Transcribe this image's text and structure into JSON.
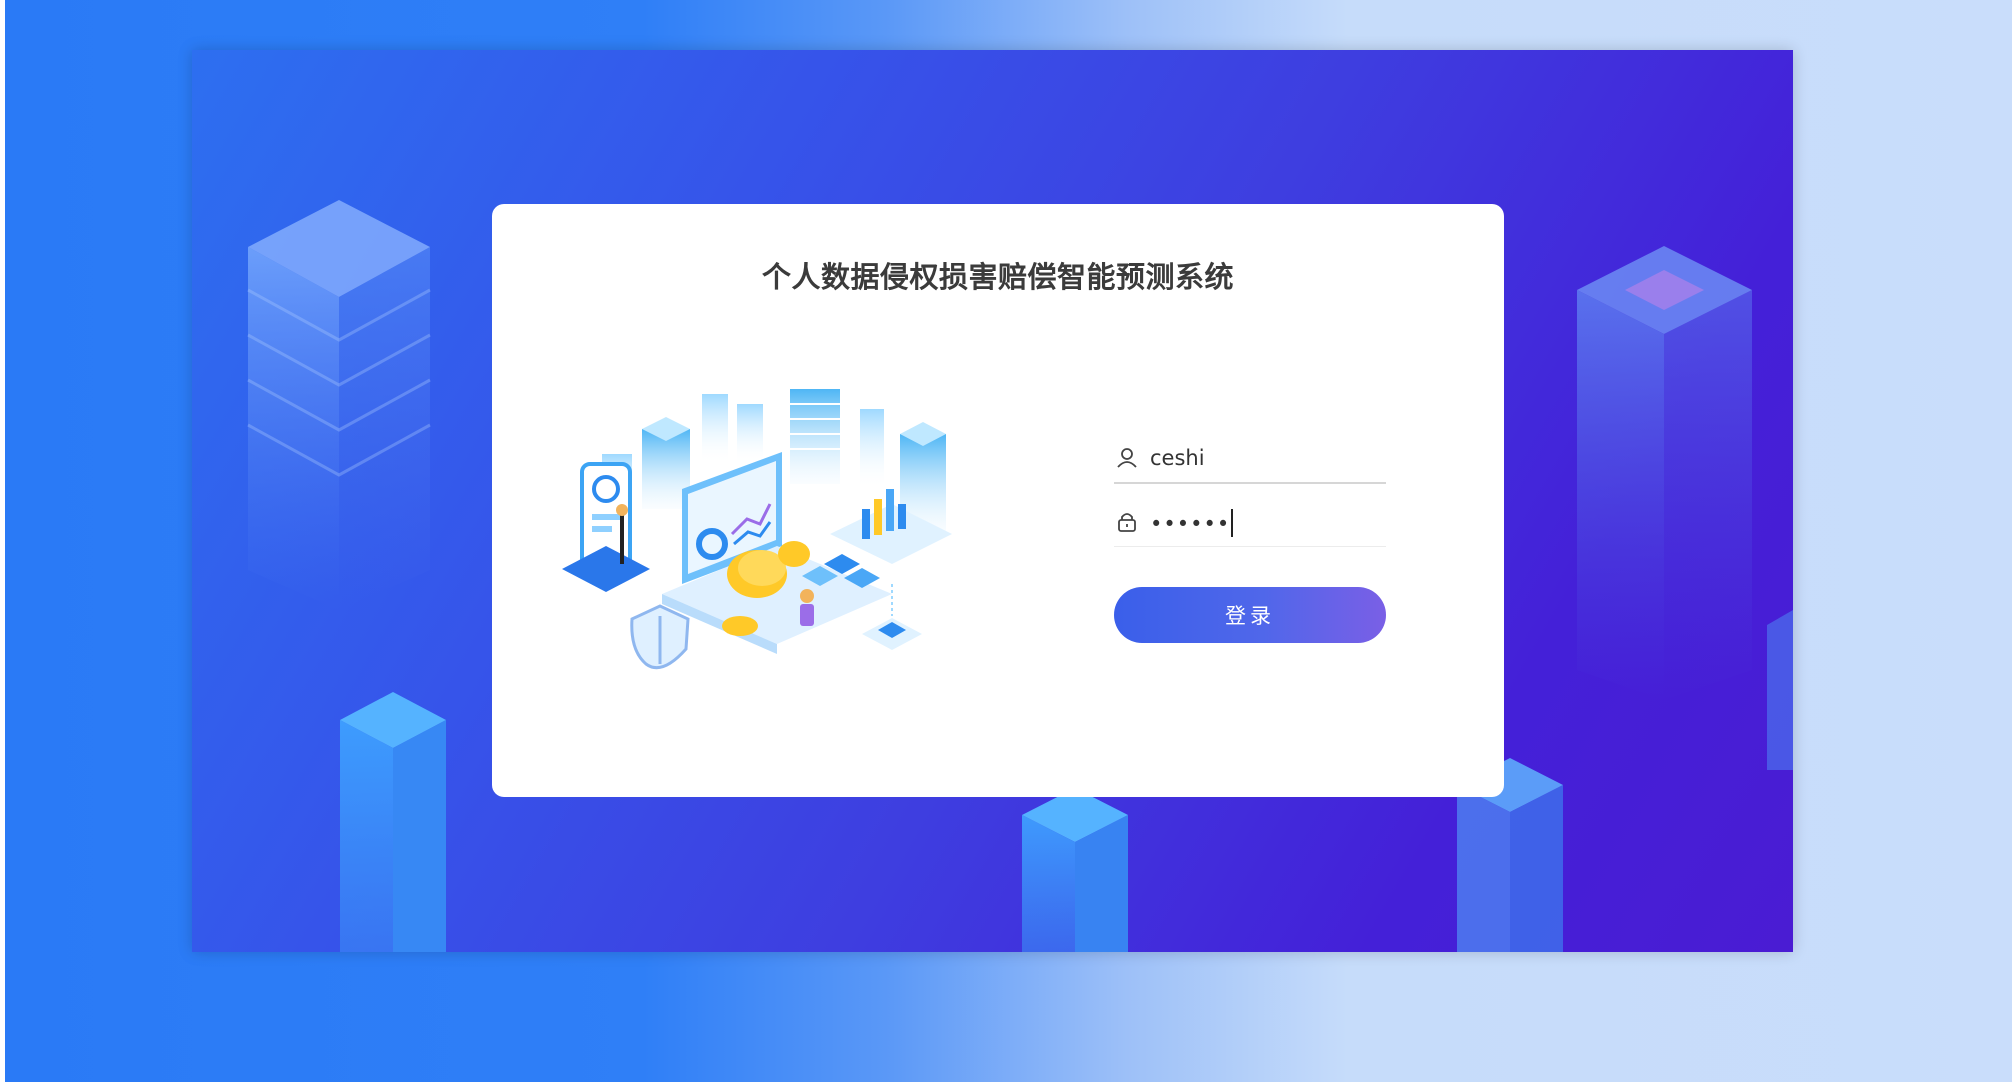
{
  "page": {
    "title": "个人数据侵权损害赔偿智能预测系统"
  },
  "login_form": {
    "username_value": "ceshi",
    "password_mask": "••••••",
    "submit_label": "登录"
  },
  "icons": {
    "username": "user-icon",
    "password": "lock-icon",
    "illustration": "data-analytics-illustration"
  },
  "colors": {
    "background_left": "#2a7af6",
    "background_right": "#c9ddfb",
    "frame_start": "#2d6ff0",
    "frame_end": "#4a1cd3",
    "button_start": "#3a5fea",
    "button_end": "#7a5fe6",
    "title_text": "#3b3b3b"
  }
}
